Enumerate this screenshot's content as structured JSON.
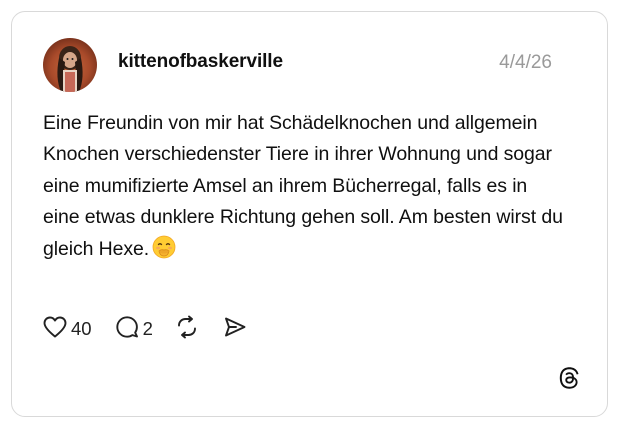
{
  "post": {
    "username": "kittenofbaskerville",
    "date": "4/4/26",
    "text": "Eine Freundin von mir hat Schädelknochen und allgemein Knochen verschiedenster Tiere in ihrer Wohnung und sogar eine mumifizierte Amsel an ihrem Bücherregal, falls es in eine etwas dunklere Richtung gehen soll. Am besten wirst du gleich Hexe.",
    "emoji": "smiling-face-with-hand-over-mouth",
    "likes": "40",
    "replies": "2"
  },
  "icons": {
    "like": "heart-icon",
    "reply": "comment-icon",
    "repost": "repost-icon",
    "share": "send-icon",
    "brand": "threads-logo"
  },
  "colors": {
    "border": "#d9d9d9",
    "text": "#101010",
    "muted": "#9a9a9a"
  }
}
